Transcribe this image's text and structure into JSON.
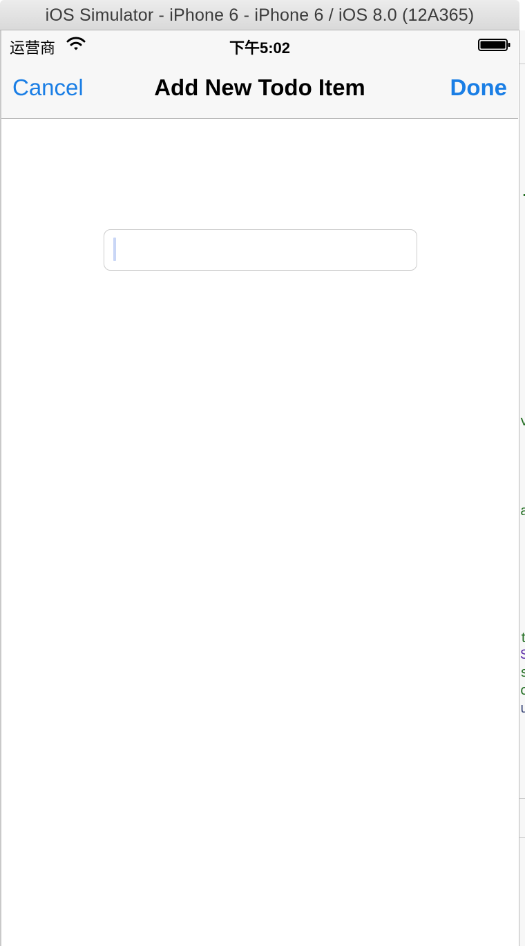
{
  "window": {
    "title": "iOS Simulator - iPhone 6 - iPhone 6 / iOS 8.0 (12A365)"
  },
  "status_bar": {
    "carrier": "运营商",
    "time": "下午5:02",
    "icons": [
      "wifi-icon",
      "battery-icon"
    ]
  },
  "nav_bar": {
    "cancel_label": "Cancel",
    "title": "Add New Todo Item",
    "done_label": "Done"
  },
  "todo_input": {
    "value": "",
    "placeholder": ""
  },
  "colors": {
    "accent": "#1a7ee5",
    "bar_background": "#f7f7f7"
  }
}
